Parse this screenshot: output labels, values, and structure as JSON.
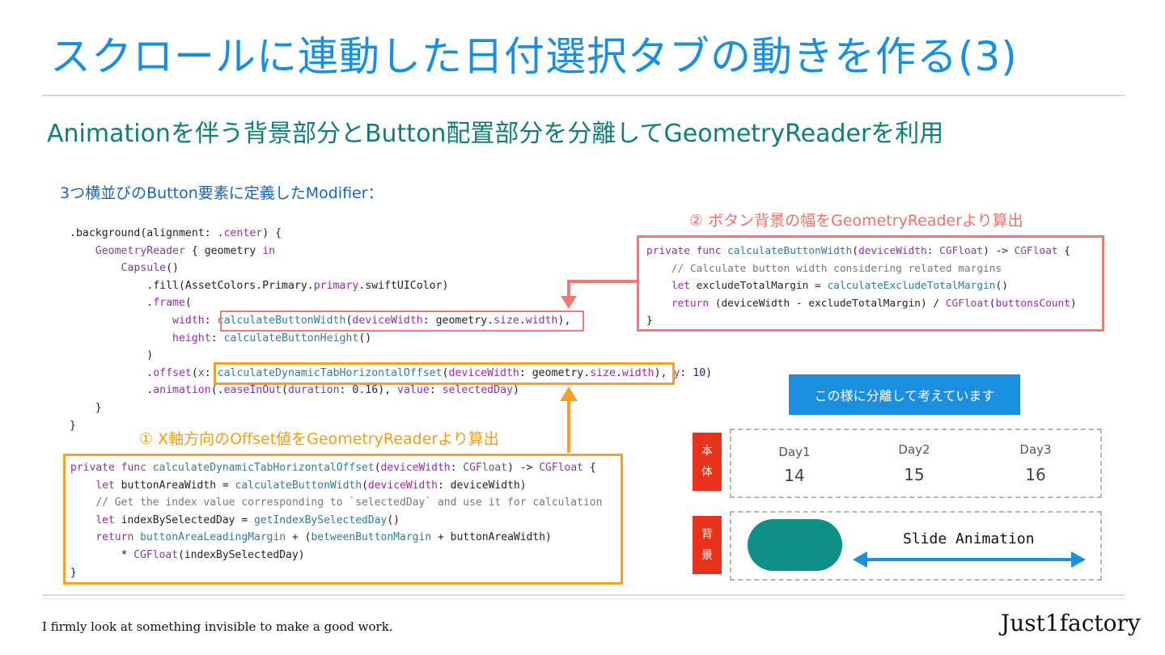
{
  "title": "スクロールに連動した日付選択タブの動きを作る(3)",
  "subtitle": "Animationを伴う背景部分とButton配置部分を分離してGeometryReaderを利用",
  "section_label": "3つ横並びのButton要素に定義したModifier：",
  "label_width": "② ボタン背景の幅をGeometryReaderより算出",
  "label_offset": "① X軸方向のOffset値をGeometryReaderより算出",
  "separated_note": "この様に分離して考えています",
  "main_tag": [
    "本",
    "体"
  ],
  "bg_tag": [
    "背",
    "景"
  ],
  "days": [
    {
      "label": "Day1",
      "num": "14"
    },
    {
      "label": "Day2",
      "num": "15"
    },
    {
      "label": "Day3",
      "num": "16"
    }
  ],
  "slide_animation": "Slide Animation",
  "footer": "I firmly look at something invisible to make a good work.",
  "brand": "Just1factory",
  "colors": {
    "title": "#1a8fe0",
    "subtitle": "#0f7e7a",
    "accent_red": "#ef7a75",
    "accent_orange": "#f5a020",
    "tag_red": "#e8311a",
    "capsule": "#0f8f86",
    "arrow_blue": "#1a8fe0"
  },
  "icons": {
    "arrow_down": "red-arrow-down-icon",
    "arrow_up": "orange-arrow-up-icon",
    "double_arrow": "double-arrow-icon"
  }
}
